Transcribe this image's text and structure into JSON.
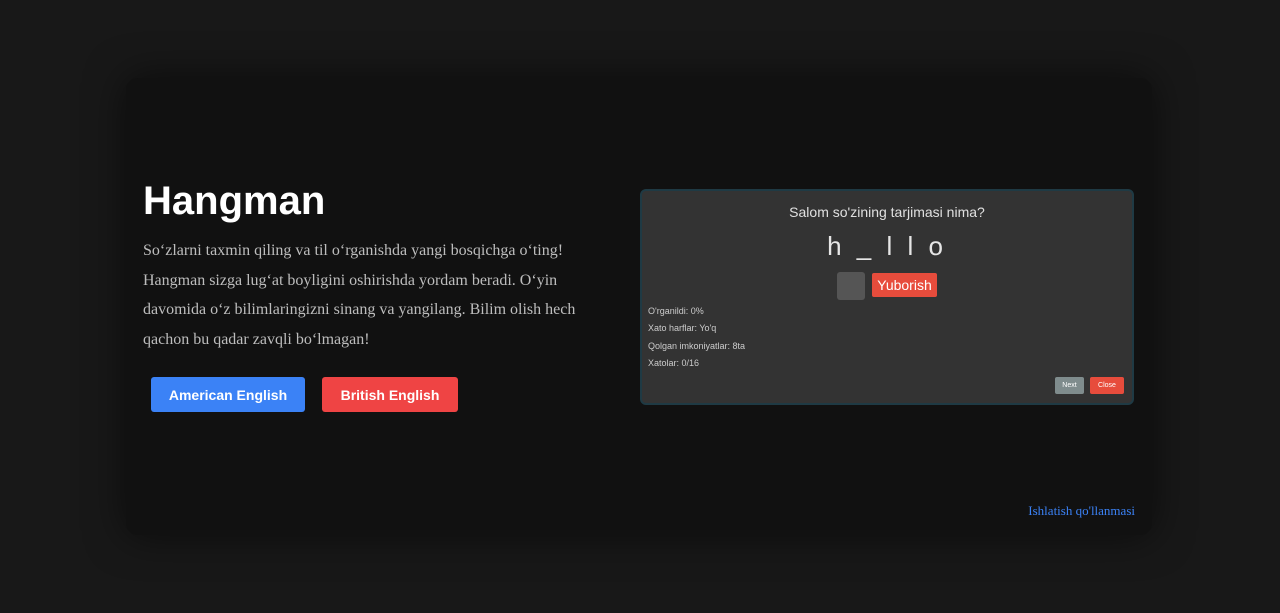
{
  "hero": {
    "title": "Hangman",
    "description": "So‘zlarni taxmin qiling va til o‘rganishda yangi bosqichga o‘ting! Hangman sizga lug‘at boyligini oshirishda yordam beradi. O‘yin davomida o‘z bilimlaringizni sinang va yangilang. Bilim olish hech qachon bu qadar zavqli bo‘lmagan!",
    "buttons": {
      "american_label": "American English",
      "british_label": "British English"
    }
  },
  "game_preview": {
    "question": "Salom so'zining tarjimasi nima?",
    "word_display": "h _ l l o",
    "letter_input_value": "",
    "submit_label": "Yuborish",
    "stats": {
      "learned": "O'rganildi: 0%",
      "wrong_letters": "Xato harflar: Yo'q",
      "remaining_chances": "Qolgan imkoniyatlar: 8ta",
      "mistakes": "Xatolar: 0/16"
    },
    "next_label": "Next",
    "close_label": "Close"
  },
  "footer": {
    "guide_link": "Ishlatish qo'llanmasi"
  },
  "colors": {
    "page_background": "#181818",
    "card_background": "#111111",
    "american_button": "#3b82f6",
    "british_button": "#ef4444",
    "submit_button": "#e74c3c",
    "next_button": "#7f8c8d",
    "link": "#3b82f6"
  }
}
